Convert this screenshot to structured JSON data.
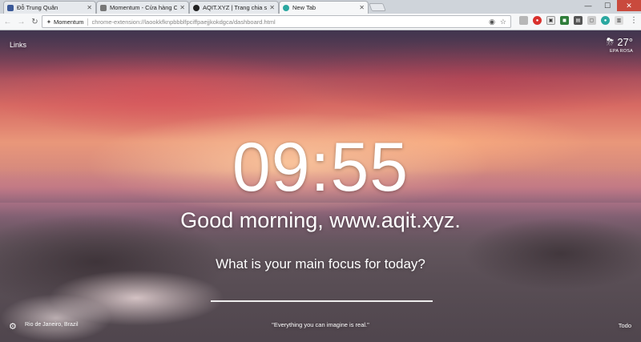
{
  "browser": {
    "tabs": [
      {
        "title": "Đỗ Trung Quân",
        "favicon_color": "#3b5998",
        "active": false
      },
      {
        "title": "Momentum - Cửa hàng C",
        "favicon_color": "#777777",
        "active": false
      },
      {
        "title": "AQIT.XYZ | Trang chia sẻ",
        "favicon_color": "#222222",
        "active": false
      },
      {
        "title": "New Tab",
        "favicon_color": "#2aa7a0",
        "active": true
      }
    ],
    "omnibox": {
      "origin": "Momentum",
      "url": "chrome-extension://laookkfknpbbblfpciffpaejjkokdgca/dashboard.html"
    }
  },
  "dashboard": {
    "links_label": "Links",
    "weather": {
      "temp": "27°",
      "location": "EPA ROSA"
    },
    "clock": "09:55",
    "greeting": "Good morning, www.aqit.xyz.",
    "focus_question": "What is your main focus for today?",
    "photo_location": "Rio de Janeiro, Brazil",
    "quote": "\"Everything you can imagine is real.\"",
    "todo_label": "Todo"
  },
  "colors": {
    "close_button": "#c94a3d",
    "tab_strip": "#cfd4da",
    "toolbar": "#f6f7f8"
  }
}
